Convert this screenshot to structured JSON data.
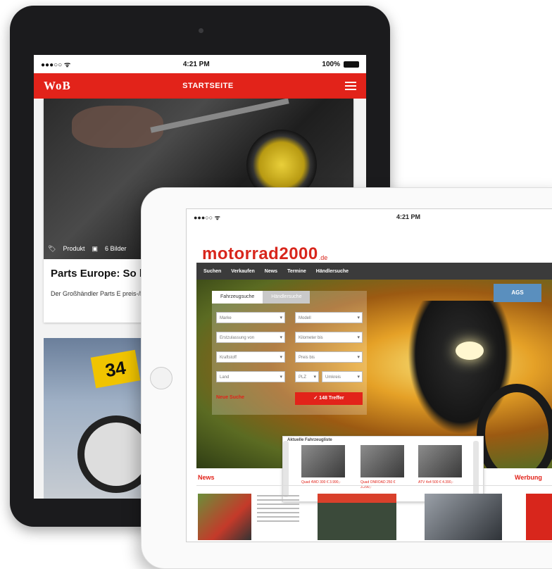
{
  "back_tablet": {
    "status": {
      "carrier": "●●●○○ ᯤ",
      "time": "4:21 PM",
      "battery": "100%"
    },
    "nav": {
      "logo": "WoB",
      "title": "STARTSEITE"
    },
    "article": {
      "meta_category": "Produkt",
      "meta_gallery": "6 Bilder",
      "headline": "Parts Europe: So k",
      "teaser": "Der Großhändler Parts E preis-/leistungsstarkes U"
    },
    "article2": {
      "badge_number": "34"
    }
  },
  "front_tablet": {
    "status": {
      "carrier": "●●●○○ ᯤ",
      "time": "4:21 PM"
    },
    "brand": {
      "name": "motorrad2000",
      "tld": ".de"
    },
    "menu": [
      "Suchen",
      "Verkaufen",
      "News",
      "Termine",
      "Händlersuche"
    ],
    "search": {
      "tabs": [
        "Fahrzeugsuche",
        "Händlersuche"
      ],
      "fields": [
        "Marke",
        "Modell",
        "Erstzulassung von",
        "Kilometer bis",
        "Kraftstoff",
        "Preis bis",
        "Land",
        "PLZ",
        "Umkreis"
      ],
      "reset": "Neue Suche",
      "button": "✓ 148 Treffer"
    },
    "badge": "AGS",
    "overlay": {
      "label": "Aktuelle Fahrzeugliste",
      "items": [
        {
          "caption": "Quad 4WD 300 € 3.990,-"
        },
        {
          "caption": "Quad ONROAD 250 € 3.290,-"
        },
        {
          "caption": "ATV 4x4 500 € 4.390,-"
        }
      ]
    },
    "sections": {
      "news": "News",
      "right": "Werbung"
    }
  }
}
